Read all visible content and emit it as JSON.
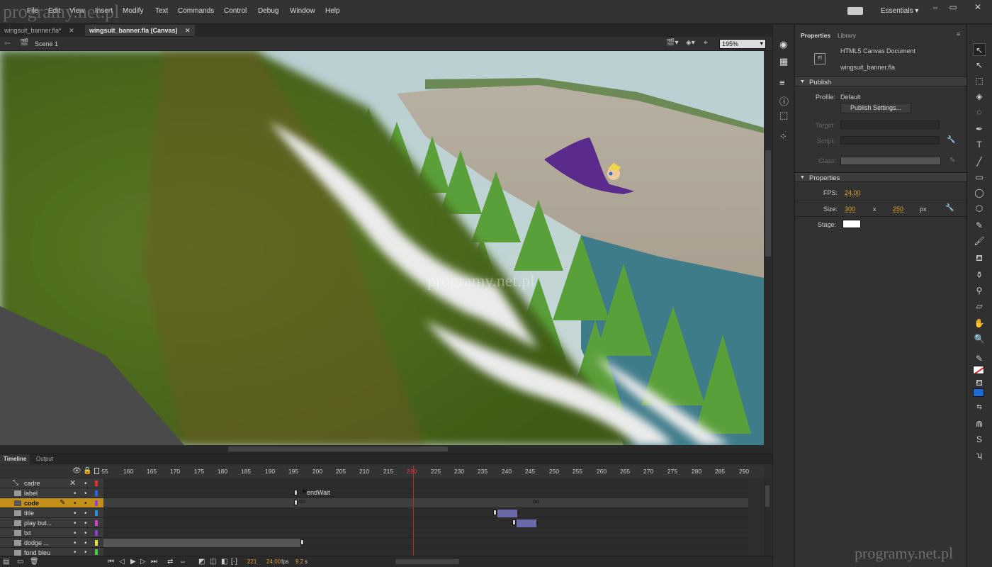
{
  "menubar": {
    "items": [
      "File",
      "Edit",
      "View",
      "Insert",
      "Modify",
      "Text",
      "Commands",
      "Control",
      "Debug",
      "Window",
      "Help"
    ],
    "workspace": "Essentials"
  },
  "doc_tabs": [
    "wingsuit_banner.fla*",
    "wingsuit_banner.fla (Canvas)"
  ],
  "scene": {
    "label": "Scene 1",
    "zoom": "195%"
  },
  "timeline": {
    "tabs": [
      "Timeline",
      "Output"
    ],
    "ruler_ticks": [
      "55",
      "160",
      "165",
      "170",
      "175",
      "180",
      "185",
      "190",
      "195",
      "200",
      "205",
      "210",
      "215",
      "220",
      "225",
      "230",
      "235",
      "240",
      "245",
      "250",
      "255",
      "260",
      "265",
      "270",
      "275",
      "280",
      "285",
      "290"
    ],
    "layers": [
      {
        "name": "cadre",
        "color": "#e03030"
      },
      {
        "name": "label",
        "color": "#3060e0"
      },
      {
        "name": "code",
        "color": "#9040d0"
      },
      {
        "name": "title",
        "color": "#3090e0"
      },
      {
        "name": "play but...",
        "color": "#d040d0"
      },
      {
        "name": "txt",
        "color": "#9040d0"
      },
      {
        "name": "dodge ...",
        "color": "#e0e030"
      },
      {
        "name": "fond bleu",
        "color": "#40d040"
      }
    ],
    "frame_label": "endWait",
    "current_frame": "221",
    "fps": "24.00",
    "fps_unit": "fps",
    "time": "9.2",
    "time_unit": "s",
    "playhead_frame": 220
  },
  "properties": {
    "tabs": [
      "Properties",
      "Library"
    ],
    "doc_type": "HTML5 Canvas Document",
    "doc_name": "wingsuit_banner.fla",
    "fl_icon": "Fl",
    "publish": {
      "header": "Publish",
      "profile_label": "Profile:",
      "profile_value": "Default",
      "settings_button": "Publish Settings...",
      "target_label": "Target:",
      "script_label": "Script:",
      "class_label": "Class:"
    },
    "props": {
      "header": "Properties",
      "fps_label": "FPS:",
      "fps_value": "24.00",
      "size_label": "Size:",
      "width": "300",
      "x_sep": "x",
      "height": "250",
      "unit": "px",
      "stage_label": "Stage:",
      "stage_color": "#ffffff"
    }
  },
  "watermark": "programy.net.pl"
}
